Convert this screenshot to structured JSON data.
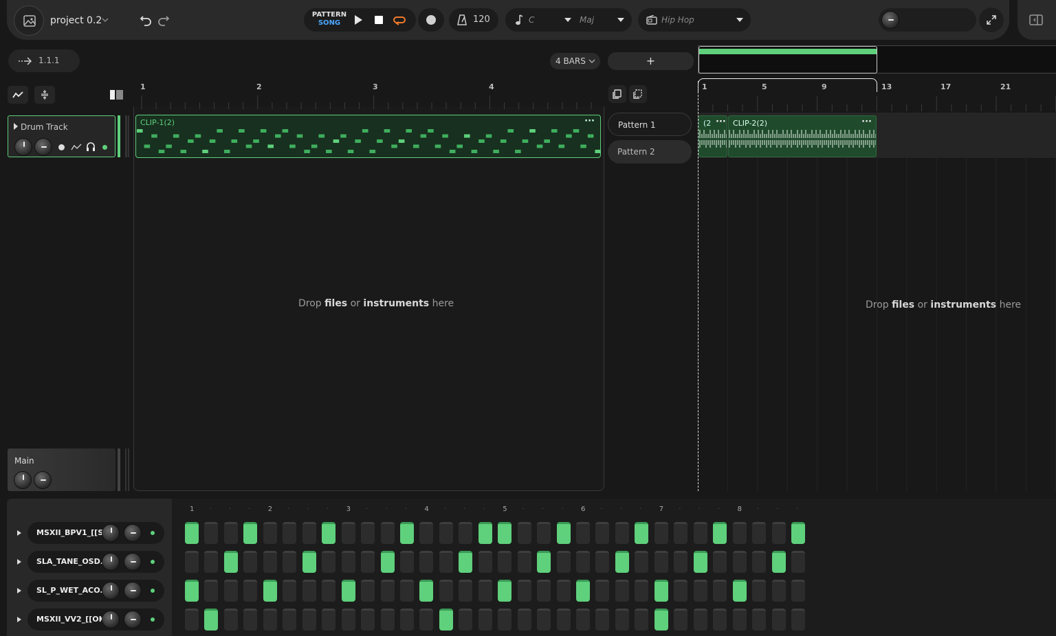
{
  "toolbar": {
    "project_name": "project 0.2",
    "mode_pattern": "PATTERN",
    "mode_song": "SONG",
    "bpm": "120",
    "key": "C",
    "scale": "Maj",
    "genre": "Hip Hop"
  },
  "position": {
    "value": "1.1.1"
  },
  "pattern_editor": {
    "bars_label": "4 BARS",
    "add_label": "+",
    "ruler": [
      "1",
      "2",
      "3",
      "4"
    ],
    "clip_name": "CLIP-1(2)",
    "drop_prefix": "Drop ",
    "drop_files": "files",
    "drop_or": " or ",
    "drop_instruments": "instruments",
    "drop_suffix": " here"
  },
  "patterns": [
    "Pattern 1",
    "Pattern 2"
  ],
  "song": {
    "ruler": [
      "1",
      "5",
      "9",
      "13",
      "17",
      "21"
    ],
    "clip_small_name": "(2",
    "clip_name": "CLIP-2(2)"
  },
  "tracks": {
    "drum_track": "Drum Track",
    "main": "Main"
  },
  "sequencer": {
    "beat_numbers": [
      "1",
      "2",
      "3",
      "4",
      "5",
      "6",
      "7",
      "8"
    ],
    "rows": [
      {
        "name": "MSXII_BPV1_[[S...",
        "steps": [
          1,
          0,
          0,
          1,
          0,
          0,
          0,
          1,
          0,
          0,
          0,
          1,
          0,
          0,
          0,
          1,
          1,
          0,
          0,
          1,
          0,
          0,
          0,
          1,
          0,
          0,
          0,
          1,
          0,
          0,
          0,
          1
        ]
      },
      {
        "name": "SLA_TANE_OSD...",
        "steps": [
          0,
          0,
          1,
          0,
          0,
          0,
          1,
          0,
          0,
          0,
          1,
          0,
          0,
          0,
          1,
          0,
          0,
          0,
          1,
          0,
          0,
          0,
          1,
          0,
          0,
          0,
          1,
          0,
          0,
          0,
          1,
          0
        ]
      },
      {
        "name": "SL_P_WET_ACO...",
        "steps": [
          1,
          0,
          0,
          0,
          1,
          0,
          0,
          0,
          1,
          0,
          0,
          0,
          1,
          0,
          0,
          0,
          1,
          0,
          0,
          0,
          1,
          0,
          0,
          0,
          1,
          0,
          0,
          0,
          1,
          0,
          0,
          0
        ]
      },
      {
        "name": "MSXII_VV2_[[OK...",
        "steps": [
          0,
          1,
          0,
          0,
          0,
          0,
          0,
          0,
          0,
          0,
          0,
          0,
          0,
          1,
          0,
          0,
          0,
          0,
          0,
          0,
          0,
          0,
          0,
          0,
          1,
          0,
          0,
          0,
          0,
          0,
          0,
          0
        ]
      }
    ]
  },
  "colors": {
    "accent": "#5fd07c",
    "loop": "#f07a2a",
    "song_blue": "#4aa8ff"
  }
}
